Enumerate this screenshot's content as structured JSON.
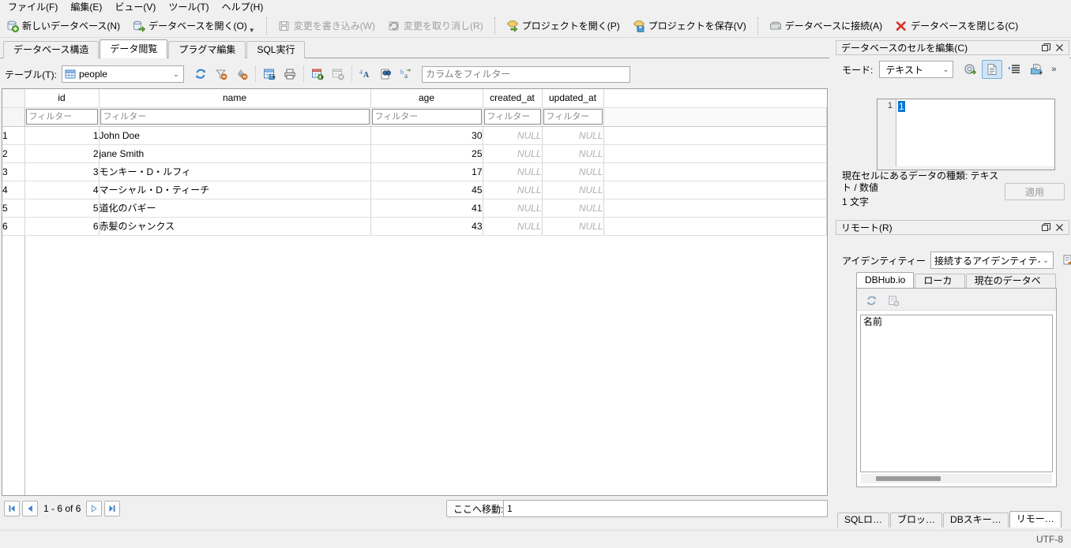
{
  "menubar": {
    "items": [
      {
        "label": "ファイル(F)",
        "name": "menu-file"
      },
      {
        "label": "編集(E)",
        "name": "menu-edit"
      },
      {
        "label": "ビュー(V)",
        "name": "menu-view"
      },
      {
        "label": "ツール(T)",
        "name": "menu-tools"
      },
      {
        "label": "ヘルプ(H)",
        "name": "menu-help"
      }
    ]
  },
  "toolbar": {
    "new_database": "新しいデータベース(N)",
    "open_database": "データベースを開く(O)",
    "write_changes": "変更を書き込み(W)",
    "revert_changes": "変更を取り消し(R)",
    "open_project": "プロジェクトを開く(P)",
    "save_project": "プロジェクトを保存(V)",
    "attach_database": "データベースに接続(A)",
    "close_database": "データベースを閉じる(C)"
  },
  "tabs": [
    {
      "label": "データベース構造",
      "name": "tab-database-structure",
      "active": false
    },
    {
      "label": "データ閲覧",
      "name": "tab-browse-data",
      "active": true
    },
    {
      "label": "プラグマ編集",
      "name": "tab-edit-pragmas",
      "active": false
    },
    {
      "label": "SQL実行",
      "name": "tab-execute-sql",
      "active": false
    }
  ],
  "browse": {
    "table_label": "テーブル(T):",
    "table_value": "people",
    "filter_placeholder": "カラムをフィルター",
    "filter_value": ""
  },
  "grid": {
    "columns": [
      "id",
      "name",
      "age",
      "created_at",
      "updated_at"
    ],
    "filter_placeholder": "フィルター",
    "null_text": "NULL",
    "rows": [
      {
        "n": "1",
        "id": "1",
        "name": "John Doe",
        "age": "30",
        "created_at": "NULL",
        "updated_at": "NULL"
      },
      {
        "n": "2",
        "id": "2",
        "name": "jane Smith",
        "age": "25",
        "created_at": "NULL",
        "updated_at": "NULL"
      },
      {
        "n": "3",
        "id": "3",
        "name": "モンキー・D・ルフィ",
        "age": "17",
        "created_at": "NULL",
        "updated_at": "NULL"
      },
      {
        "n": "4",
        "id": "4",
        "name": "マーシャル・D・ティーチ",
        "age": "45",
        "created_at": "NULL",
        "updated_at": "NULL"
      },
      {
        "n": "5",
        "id": "5",
        "name": "道化のバギー",
        "age": "41",
        "created_at": "NULL",
        "updated_at": "NULL"
      },
      {
        "n": "6",
        "id": "6",
        "name": "赤髪のシャンクス",
        "age": "43",
        "created_at": "NULL",
        "updated_at": "NULL"
      }
    ]
  },
  "navigation": {
    "range_text": "1 - 6 of 6",
    "goto_label": "ここへ移動:",
    "goto_value": "1"
  },
  "cell_editor": {
    "title": "データベースのセルを編集(C)",
    "mode_label": "モード:",
    "mode_value": "テキスト",
    "line_number": "1",
    "content": "1",
    "type_info": "現在セルにあるデータの種類: テキスト / 数値",
    "size_info": "1 文字",
    "apply_label": "適用",
    "more_label": "»"
  },
  "remote": {
    "title": "リモート(R)",
    "identity_label": "アイデンティティー",
    "identity_value": "接続するアイデンティティー",
    "tabs": [
      {
        "label": "DBHub.io",
        "name": "remote-tab-dbhub",
        "active": true
      },
      {
        "label": "ローカル",
        "name": "remote-tab-local",
        "active": false
      },
      {
        "label": "現在のデータベース",
        "name": "remote-tab-current-database",
        "active": false
      }
    ],
    "list_header": "名前"
  },
  "status_tabs": [
    {
      "label": "SQLロ…",
      "name": "status-tab-sql-log",
      "active": false
    },
    {
      "label": "ブロッ…",
      "name": "status-tab-plot",
      "active": false
    },
    {
      "label": "DBスキー…",
      "name": "status-tab-db-schema",
      "active": false
    },
    {
      "label": "リモー…",
      "name": "status-tab-remote",
      "active": true
    }
  ],
  "statusbar": {
    "encoding": "UTF-8"
  },
  "colors": {
    "accent": "#0a76d6",
    "window_bg": "#f0f0f0",
    "grid_bg": "#ffffff",
    "null_text": "#b0b0b0",
    "close_red": "#d93025"
  }
}
